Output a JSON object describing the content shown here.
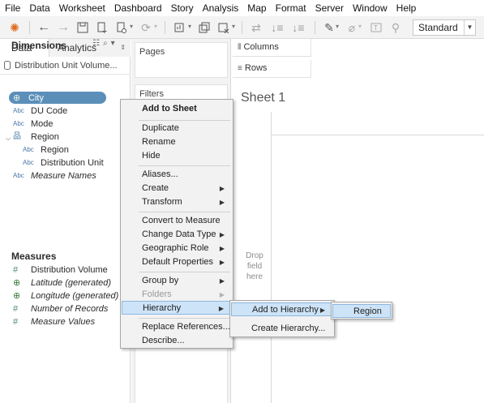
{
  "menubar": [
    "File",
    "Data",
    "Worksheet",
    "Dashboard",
    "Story",
    "Analysis",
    "Map",
    "Format",
    "Server",
    "Window",
    "Help"
  ],
  "toolbar": {
    "view_select": "Standard"
  },
  "datapane": {
    "tab_data": "Data",
    "tab_analytics": "Analytics",
    "datasource": "Distribution Unit Volume...",
    "dimensions_title": "Dimensions",
    "dimensions": [
      {
        "type": "Abc",
        "label": "DU Code"
      },
      {
        "type": "Abc",
        "label": "Mode"
      },
      {
        "type": "hier",
        "label": "Region"
      },
      {
        "type": "Abc",
        "label": "Region"
      },
      {
        "type": "Abc",
        "label": "Distribution Unit"
      },
      {
        "type": "Abc",
        "label": "Measure Names"
      }
    ],
    "selected_field": "City",
    "measures_title": "Measures",
    "measures": [
      {
        "type": "#",
        "label": "Distribution Volume"
      },
      {
        "type": "globe",
        "label": "Latitude (generated)"
      },
      {
        "type": "globe",
        "label": "Longitude (generated)"
      },
      {
        "type": "#",
        "label": "Number of Records"
      },
      {
        "type": "#",
        "label": "Measure Values"
      }
    ]
  },
  "shelves": {
    "pages": "Pages",
    "filters": "Filters",
    "columns": "Columns",
    "rows": "Rows",
    "drop_hint": [
      "Drop",
      "field",
      "here"
    ]
  },
  "sheet_title": "Sheet 1",
  "context_menu": {
    "items": [
      {
        "label": "Add to Sheet",
        "bold": true
      },
      {
        "label": "Duplicate"
      },
      {
        "label": "Rename"
      },
      {
        "label": "Hide"
      },
      {
        "label": "Aliases..."
      },
      {
        "label": "Create",
        "submenu": true
      },
      {
        "label": "Transform",
        "submenu": true
      },
      {
        "label": "Convert to Measure"
      },
      {
        "label": "Change Data Type",
        "submenu": true
      },
      {
        "label": "Geographic Role",
        "submenu": true
      },
      {
        "label": "Default Properties",
        "submenu": true
      },
      {
        "label": "Group by",
        "submenu": true
      },
      {
        "label": "Folders",
        "submenu": true,
        "disabled": true
      },
      {
        "label": "Hierarchy",
        "submenu": true,
        "highlighted": true
      },
      {
        "label": "Replace References..."
      },
      {
        "label": "Describe..."
      }
    ]
  },
  "hierarchy_menu": {
    "items": [
      {
        "label": "Add to Hierarchy",
        "submenu": true,
        "highlighted": true
      },
      {
        "label": "Create Hierarchy..."
      }
    ]
  },
  "add_to_hierarchy_menu": {
    "items": [
      {
        "label": "Region",
        "highlighted": true
      }
    ]
  }
}
